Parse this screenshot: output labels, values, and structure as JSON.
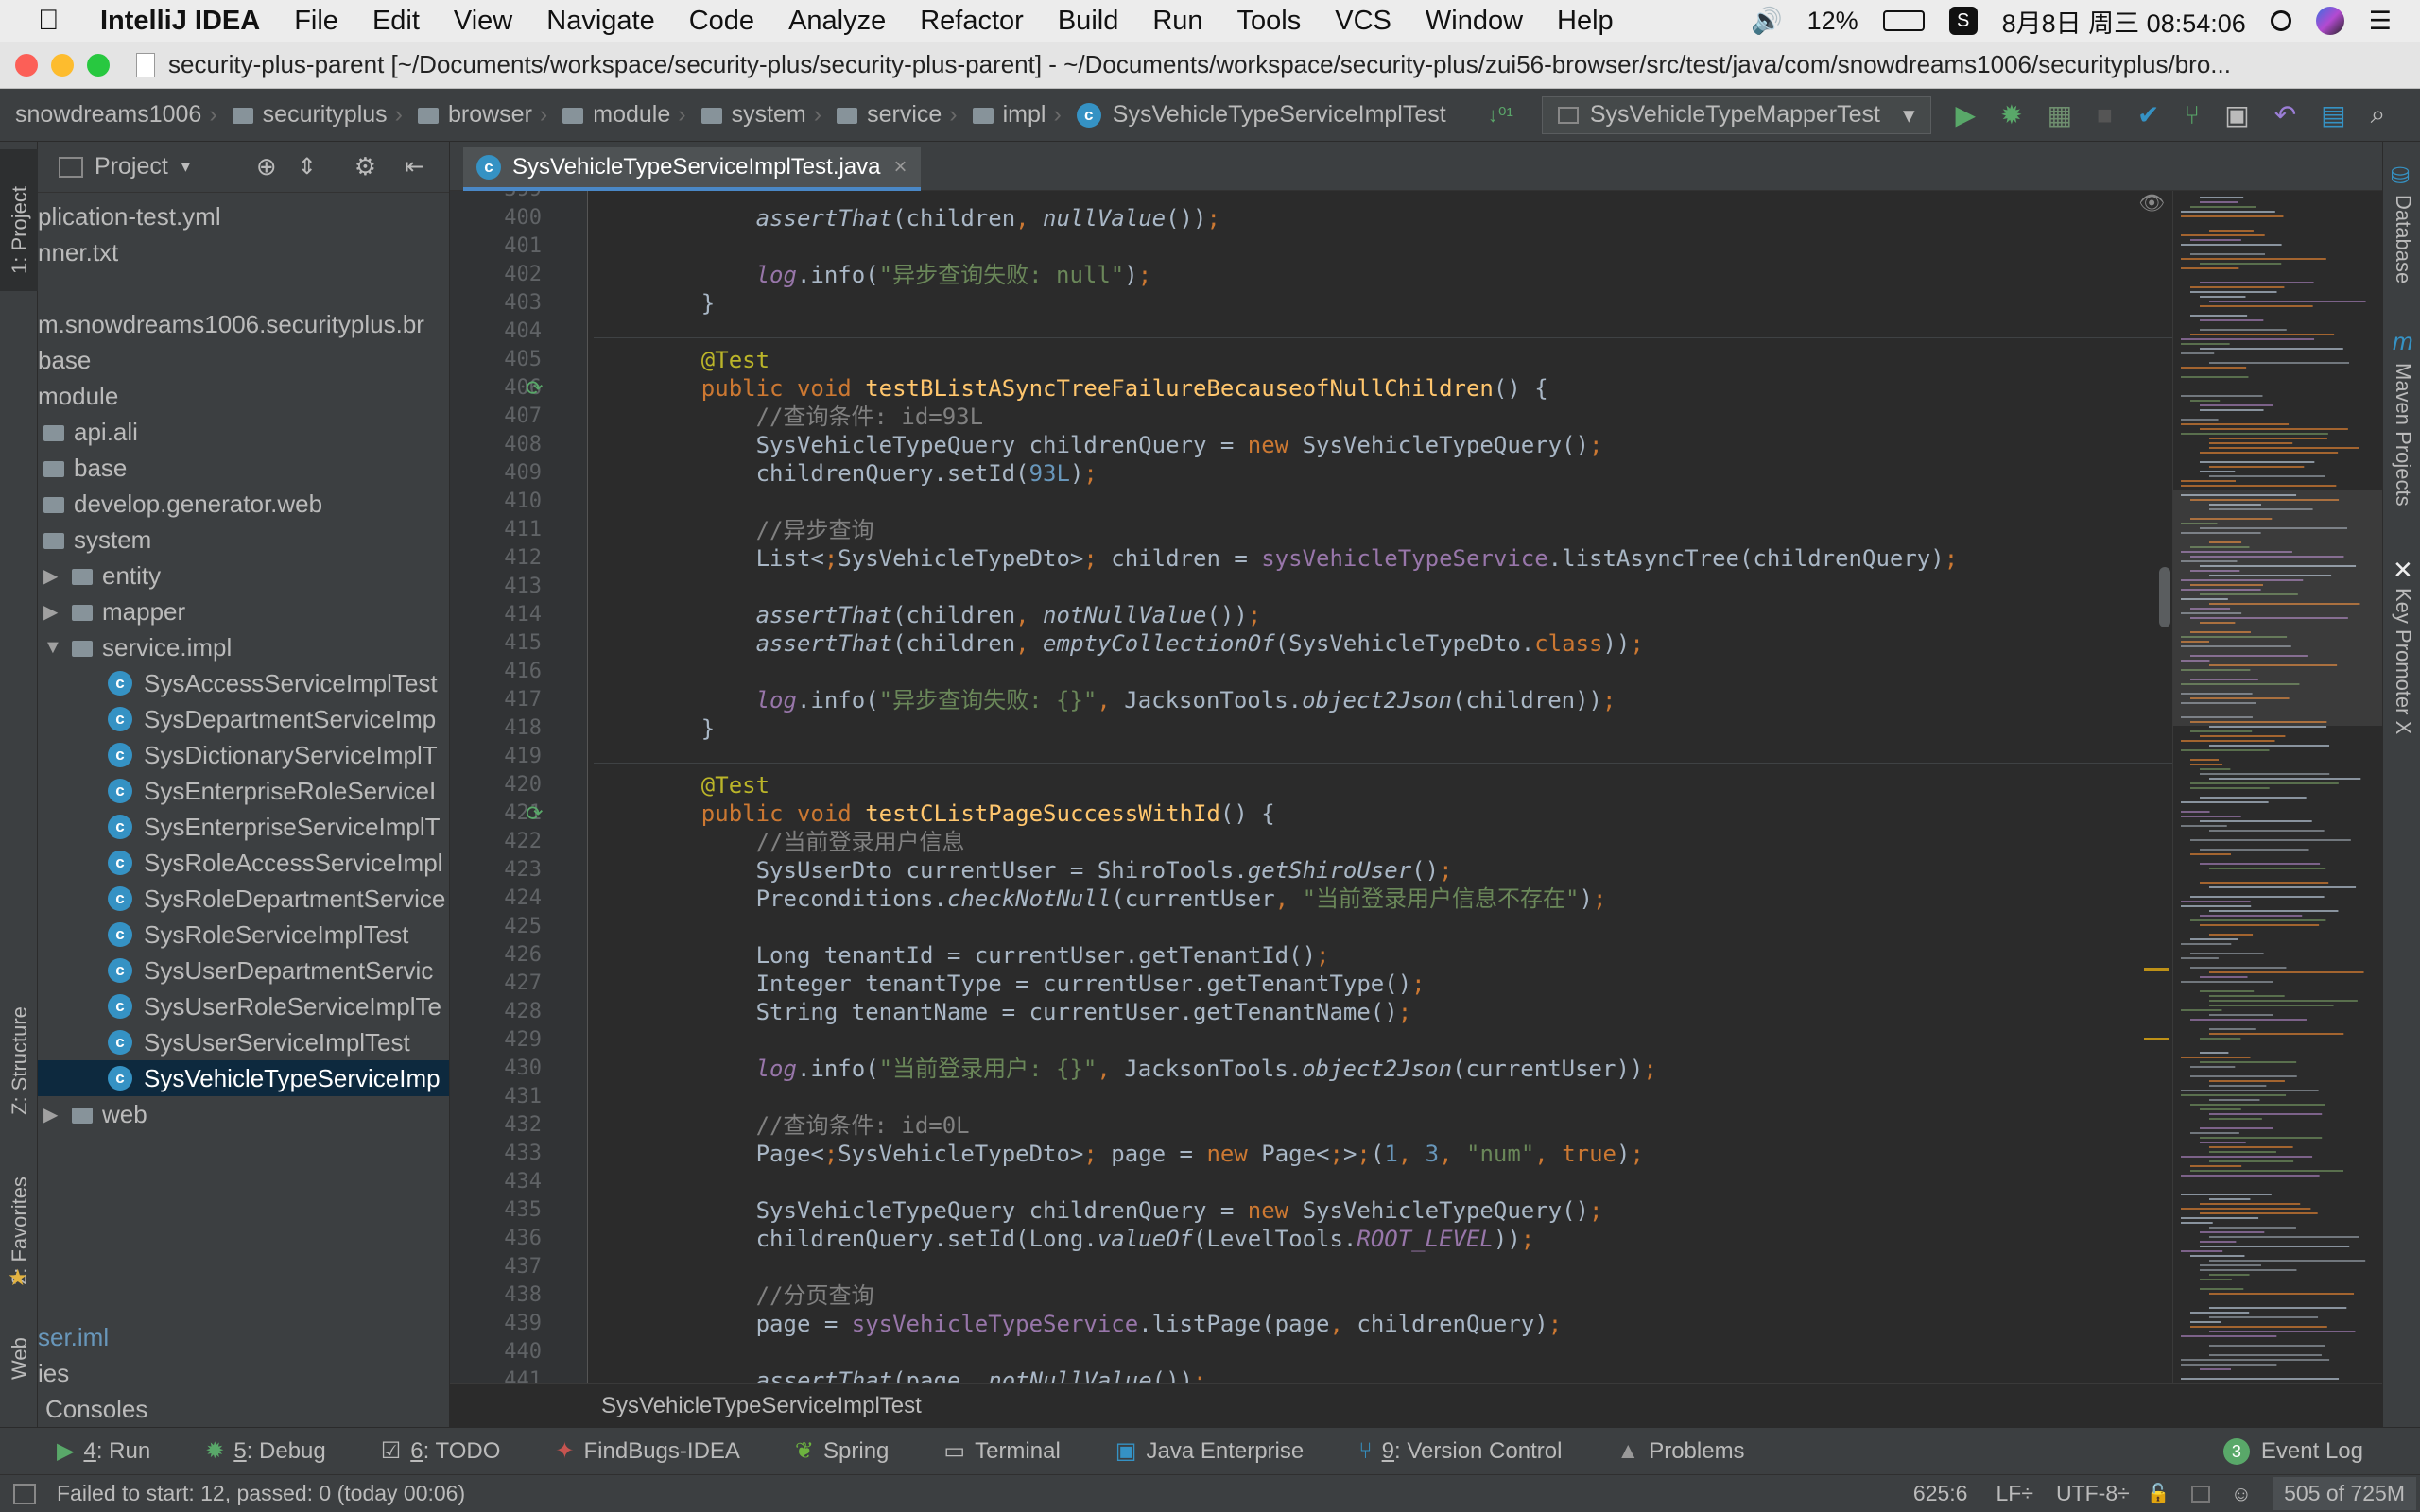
{
  "menubar": {
    "app_name": "IntelliJ IDEA",
    "items": [
      "File",
      "Edit",
      "View",
      "Navigate",
      "Code",
      "Analyze",
      "Refactor",
      "Build",
      "Run",
      "Tools",
      "VCS",
      "Window",
      "Help"
    ],
    "battery": "12%",
    "datetime": "8月8日 周三 08:54:06"
  },
  "window": {
    "title": "security-plus-parent [~/Documents/workspace/security-plus/security-plus-parent] - ~/Documents/workspace/security-plus/zui56-browser/src/test/java/com/snowdreams1006/securityplus/bro..."
  },
  "navbar": {
    "crumbs": [
      "snowdreams1006",
      "securityplus",
      "browser",
      "module",
      "system",
      "service",
      "impl",
      "SysVehicleTypeServiceImplTest"
    ],
    "run_config": "SysVehicleTypeMapperTest"
  },
  "project_panel": {
    "title": "Project",
    "rows": [
      {
        "text": "plication-test.yml",
        "indent": 0,
        "kind": "file"
      },
      {
        "text": "nner.txt",
        "indent": 0,
        "kind": "file"
      },
      {
        "text": "",
        "indent": 0,
        "kind": "blank"
      },
      {
        "text": "m.snowdreams1006.securityplus.br",
        "indent": 0,
        "kind": "pkg"
      },
      {
        "text": "base",
        "indent": 0,
        "kind": "pkg"
      },
      {
        "text": "module",
        "indent": 0,
        "kind": "pkg"
      },
      {
        "text": "api.ali",
        "indent": 0,
        "kind": "folder"
      },
      {
        "text": "base",
        "indent": 0,
        "kind": "folder"
      },
      {
        "text": "develop.generator.web",
        "indent": 0,
        "kind": "folder"
      },
      {
        "text": "system",
        "indent": 0,
        "kind": "folder"
      },
      {
        "text": "entity",
        "indent": 1,
        "kind": "folder-collapsed"
      },
      {
        "text": "mapper",
        "indent": 1,
        "kind": "folder-collapsed"
      },
      {
        "text": "service.impl",
        "indent": 1,
        "kind": "folder-expanded"
      },
      {
        "text": "SysAccessServiceImplTest",
        "indent": 2,
        "kind": "class"
      },
      {
        "text": "SysDepartmentServiceImp",
        "indent": 2,
        "kind": "class"
      },
      {
        "text": "SysDictionaryServiceImplT",
        "indent": 2,
        "kind": "class"
      },
      {
        "text": "SysEnterpriseRoleServiceI",
        "indent": 2,
        "kind": "class"
      },
      {
        "text": "SysEnterpriseServiceImplT",
        "indent": 2,
        "kind": "class"
      },
      {
        "text": "SysRoleAccessServiceImpl",
        "indent": 2,
        "kind": "class"
      },
      {
        "text": "SysRoleDepartmentService",
        "indent": 2,
        "kind": "class"
      },
      {
        "text": "SysRoleServiceImplTest",
        "indent": 2,
        "kind": "class"
      },
      {
        "text": "SysUserDepartmentServic",
        "indent": 2,
        "kind": "class"
      },
      {
        "text": "SysUserRoleServiceImplTe",
        "indent": 2,
        "kind": "class"
      },
      {
        "text": "SysUserServiceImplTest",
        "indent": 2,
        "kind": "class"
      },
      {
        "text": "SysVehicleTypeServiceImp",
        "indent": 2,
        "kind": "class-selected"
      },
      {
        "text": "web",
        "indent": 1,
        "kind": "folder-collapsed"
      }
    ],
    "bottom_rows": [
      "ser.iml",
      "ies",
      "Consoles"
    ]
  },
  "left_stripe": {
    "project": "1: Project",
    "structure": "Z: Structure",
    "favorites": "2: Favorites",
    "web": "Web"
  },
  "right_stripe": {
    "database": "Database",
    "maven": "Maven Projects",
    "key_promoter": "Key Promoter X"
  },
  "editor": {
    "tab_label": "SysVehicleTypeServiceImplTest.java",
    "bottom_breadcrumb": "SysVehicleTypeServiceImplTest",
    "first_line": 399,
    "lines": [
      "",
      "        assertThat(children, nullValue());",
      "",
      "        log.info(\"异步查询失败: null\");",
      "    }",
      "",
      "    @Test",
      "    public void testBListASyncTreeFailureBecauseofNullChildren() {",
      "        //查询条件: id=93L",
      "        SysVehicleTypeQuery childrenQuery = new SysVehicleTypeQuery();",
      "        childrenQuery.setId(93L);",
      "",
      "        //异步查询",
      "        List<SysVehicleTypeDto> children = sysVehicleTypeService.listAsyncTree(childrenQuery);",
      "",
      "        assertThat(children, notNullValue());",
      "        assertThat(children, emptyCollectionOf(SysVehicleTypeDto.class));",
      "",
      "        log.info(\"异步查询失败: {}\", JacksonTools.object2Json(children));",
      "    }",
      "",
      "    @Test",
      "    public void testCListPageSuccessWithId() {",
      "        //当前登录用户信息",
      "        SysUserDto currentUser = ShiroTools.getShiroUser();",
      "        Preconditions.checkNotNull(currentUser, \"当前登录用户信息不存在\");",
      "",
      "        Long tenantId = currentUser.getTenantId();",
      "        Integer tenantType = currentUser.getTenantType();",
      "        String tenantName = currentUser.getTenantName();",
      "",
      "        log.info(\"当前登录用户: {}\", JacksonTools.object2Json(currentUser));",
      "",
      "        //查询条件: id=0L",
      "        Page<SysVehicleTypeDto> page = new Page<>(1, 3, \"num\", true);",
      "",
      "        SysVehicleTypeQuery childrenQuery = new SysVehicleTypeQuery();",
      "        childrenQuery.setId(Long.valueOf(LevelTools.ROOT_LEVEL));",
      "",
      "        //分页查询",
      "        page = sysVehicleTypeService.listPage(page, childrenQuery);",
      "",
      "        assertThat(page, notNullValue());"
    ]
  },
  "bottom_tools": [
    {
      "key": "4",
      "label": ": Run",
      "icon": "run-icon"
    },
    {
      "key": "5",
      "label": ": Debug",
      "icon": "debug-icon"
    },
    {
      "key": "6",
      "label": ": TODO",
      "icon": "todo-icon"
    },
    {
      "key": "",
      "label": "FindBugs-IDEA",
      "icon": "findbugs-icon"
    },
    {
      "key": "",
      "label": "Spring",
      "icon": "spring-icon"
    },
    {
      "key": "",
      "label": "Terminal",
      "icon": "terminal-icon"
    },
    {
      "key": "",
      "label": "Java Enterprise",
      "icon": "java-enterprise-icon"
    },
    {
      "key": "9",
      "label": ": Version Control",
      "icon": "vcs-icon"
    },
    {
      "key": "",
      "label": "Problems",
      "icon": "problems-icon"
    }
  ],
  "event_log": {
    "badge": "3",
    "label": "Event Log"
  },
  "status": {
    "message": "Failed to start: 12, passed: 0 (today 00:06)",
    "position": "625:6",
    "line_sep": "LF÷",
    "encoding": "UTF-8÷",
    "memory": "505 of 725M"
  },
  "colors": {
    "keyword": "#cc7832",
    "string": "#6a8759",
    "comment": "#808080",
    "annotation": "#bbb529",
    "number": "#6897bb",
    "field": "#9876aa",
    "method_decl": "#ffc66d",
    "accent": "#4a88c7"
  }
}
